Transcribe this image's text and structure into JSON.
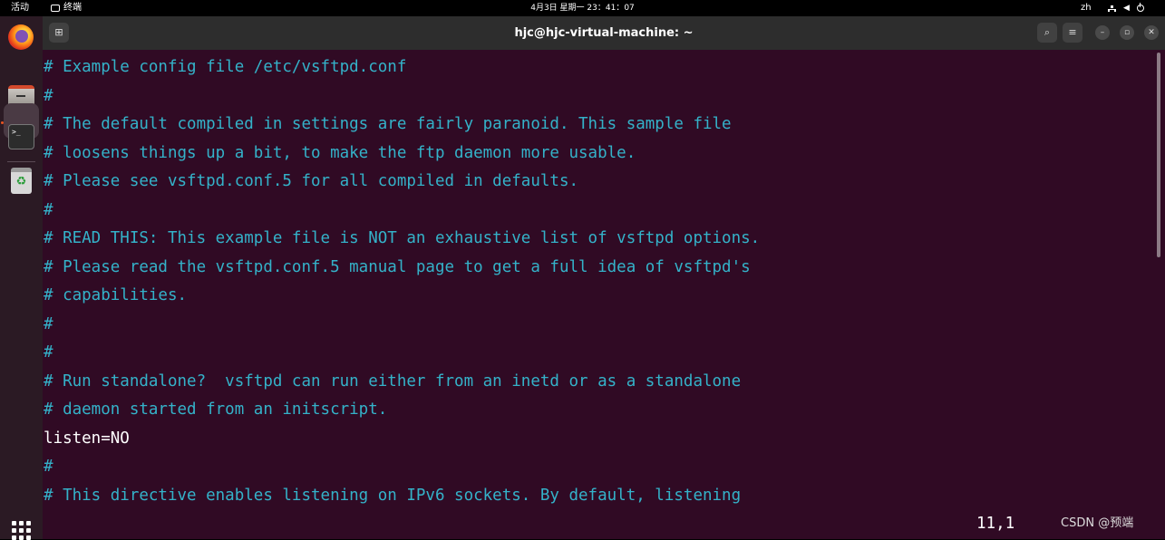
{
  "topbar": {
    "activities": "活动",
    "app_name": "终端",
    "clock": "4月3日 星期一  23：41：07",
    "input_method": "zh"
  },
  "dock": {
    "items": [
      "firefox",
      "files",
      "terminal",
      "trash"
    ]
  },
  "window": {
    "title": "hjc@hjc-virtual-machine: ~"
  },
  "terminal": {
    "lines": [
      {
        "text": "# Example config file /etc/vsftpd.conf",
        "kind": "comment"
      },
      {
        "text": "#",
        "kind": "comment"
      },
      {
        "text": "# The default compiled in settings are fairly paranoid. This sample file",
        "kind": "comment"
      },
      {
        "text": "# loosens things up a bit, to make the ftp daemon more usable.",
        "kind": "comment"
      },
      {
        "text": "# Please see vsftpd.conf.5 for all compiled in defaults.",
        "kind": "comment"
      },
      {
        "text": "#",
        "kind": "comment"
      },
      {
        "text": "# READ THIS: This example file is NOT an exhaustive list of vsftpd options.",
        "kind": "comment"
      },
      {
        "text": "# Please read the vsftpd.conf.5 manual page to get a full idea of vsftpd's",
        "kind": "comment"
      },
      {
        "text": "# capabilities.",
        "kind": "comment"
      },
      {
        "text": "#",
        "kind": "comment"
      },
      {
        "text": "#",
        "kind": "comment"
      },
      {
        "text": "# Run standalone?  vsftpd can run either from an inetd or as a standalone",
        "kind": "comment"
      },
      {
        "text": "# daemon started from an initscript.",
        "kind": "comment"
      },
      {
        "text": "listen=NO",
        "kind": "plain"
      },
      {
        "text": "#",
        "kind": "comment"
      },
      {
        "text": "# This directive enables listening on IPv6 sockets. By default, listening",
        "kind": "comment"
      }
    ],
    "cursor_position": "11,1",
    "watermark": "CSDN @预端"
  },
  "colors": {
    "terminal_bg": "#300a24",
    "comment": "#34b2c9",
    "plain": "#ffffff",
    "accent": "#e95420"
  }
}
